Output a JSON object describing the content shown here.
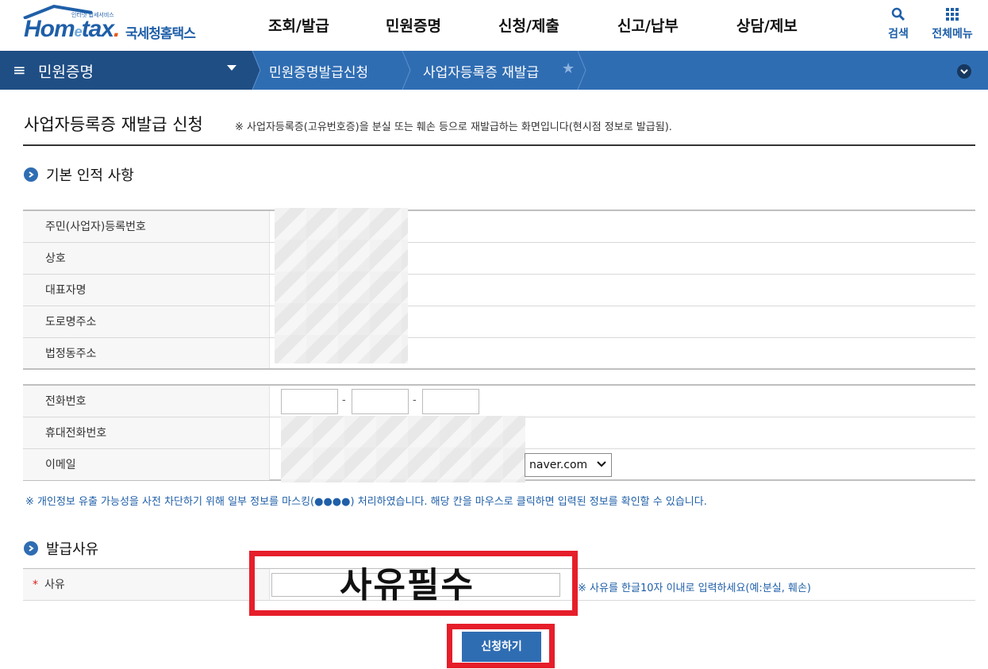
{
  "header": {
    "logo_small": "인터넷 납세서비스",
    "logo_main_1": "Hom",
    "logo_main_e": "e",
    "logo_main_2": "tax",
    "logo_main_dot": ".",
    "logo_korean": "국세청홈택스",
    "nav": [
      "조회/발급",
      "민원증명",
      "신청/제출",
      "신고/납부",
      "상담/제보"
    ],
    "search_label": "검색",
    "allmenu_label": "전체메뉴",
    "brand_color": "#1f5fa8"
  },
  "locbar": {
    "menu_label": "민원증명",
    "crumb_1": "민원증명발급신청",
    "crumb_2": "사업자등록증 재발급",
    "star_icon": "star-icon",
    "bar_color": "#2f6db3"
  },
  "page": {
    "title": "사업자등록증 재발급 신청",
    "title_note": "※ 사업자등록증(고유번호증)을 분실 또는 훼손 등으로 재발급하는 화면입니다(현시점 정보로 발급됨)."
  },
  "basic": {
    "heading": "기본 인적 사항",
    "rows": [
      "주민(사업자)등록번호",
      "상호",
      "대표자명",
      "도로명주소",
      "법정동주소"
    ]
  },
  "contact": {
    "rows": [
      "전화번호",
      "휴대전화번호",
      "이메일"
    ],
    "tel_dash": "-",
    "email_domain": "naver.com"
  },
  "privacy_note": "※ 개인정보 유출 가능성을 사전 차단하기 위해 일부 정보를 마스킹(●●●●) 처리하였습니다. 해당 칸을 마우스로 클릭하면 입력된 정보를 확인할 수 있습니다.",
  "reason": {
    "heading": "발급사유",
    "required_mark": "*",
    "label": "사유",
    "note": "※ 사유를 한글10자 이내로 입력하세요(예:분실, 훼손)",
    "overlay_text": "사유필수",
    "overlay_color": "#e61e2a"
  },
  "submit_label": "신청하기"
}
